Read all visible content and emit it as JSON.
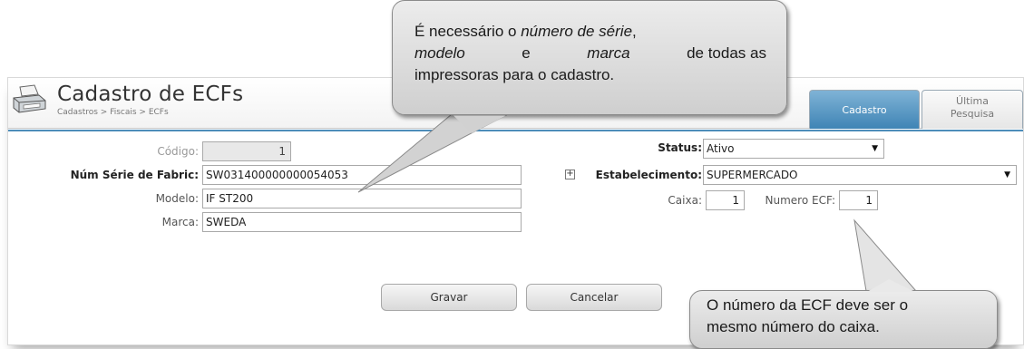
{
  "header": {
    "title": "Cadastro de ECFs",
    "breadcrumb": "Cadastros > Fiscais > ECFs"
  },
  "tabs": [
    {
      "label": "Cadastro",
      "active": true
    },
    {
      "label_line1": "Última",
      "label_line2": "Pesquisa",
      "active": false
    }
  ],
  "form": {
    "codigo": {
      "label": "Código:",
      "value": "1"
    },
    "num_serie": {
      "label": "Núm Série de Fabric:",
      "value": "SW031400000000054053"
    },
    "modelo": {
      "label": "Modelo:",
      "value": "IF ST200"
    },
    "marca": {
      "label": "Marca:",
      "value": "SWEDA"
    },
    "status": {
      "label": "Status:",
      "value": "Ativo"
    },
    "estabelecimento": {
      "label": "Estabelecimento:",
      "value": "SUPERMERCADO"
    },
    "caixa": {
      "label": "Caixa:",
      "value": "1"
    },
    "numero_ecf": {
      "label": "Numero ECF:",
      "value": "1"
    }
  },
  "buttons": {
    "gravar": "Gravar",
    "cancelar": "Cancelar"
  },
  "callouts": {
    "top": {
      "line1_a": "É necessário o ",
      "line1_b": "número de série",
      "line1_c": ",",
      "line2_a": "modelo",
      "line2_b": " e ",
      "line2_c": "marca",
      "line2_d": " de todas as",
      "line3": "impressoras para o cadastro."
    },
    "bottom": {
      "line1": "O número da ECF deve ser o",
      "line2": "mesmo número do caixa."
    }
  },
  "colors": {
    "tab_active": "#4d8dba",
    "callout_bg": "#dcdcdc"
  }
}
